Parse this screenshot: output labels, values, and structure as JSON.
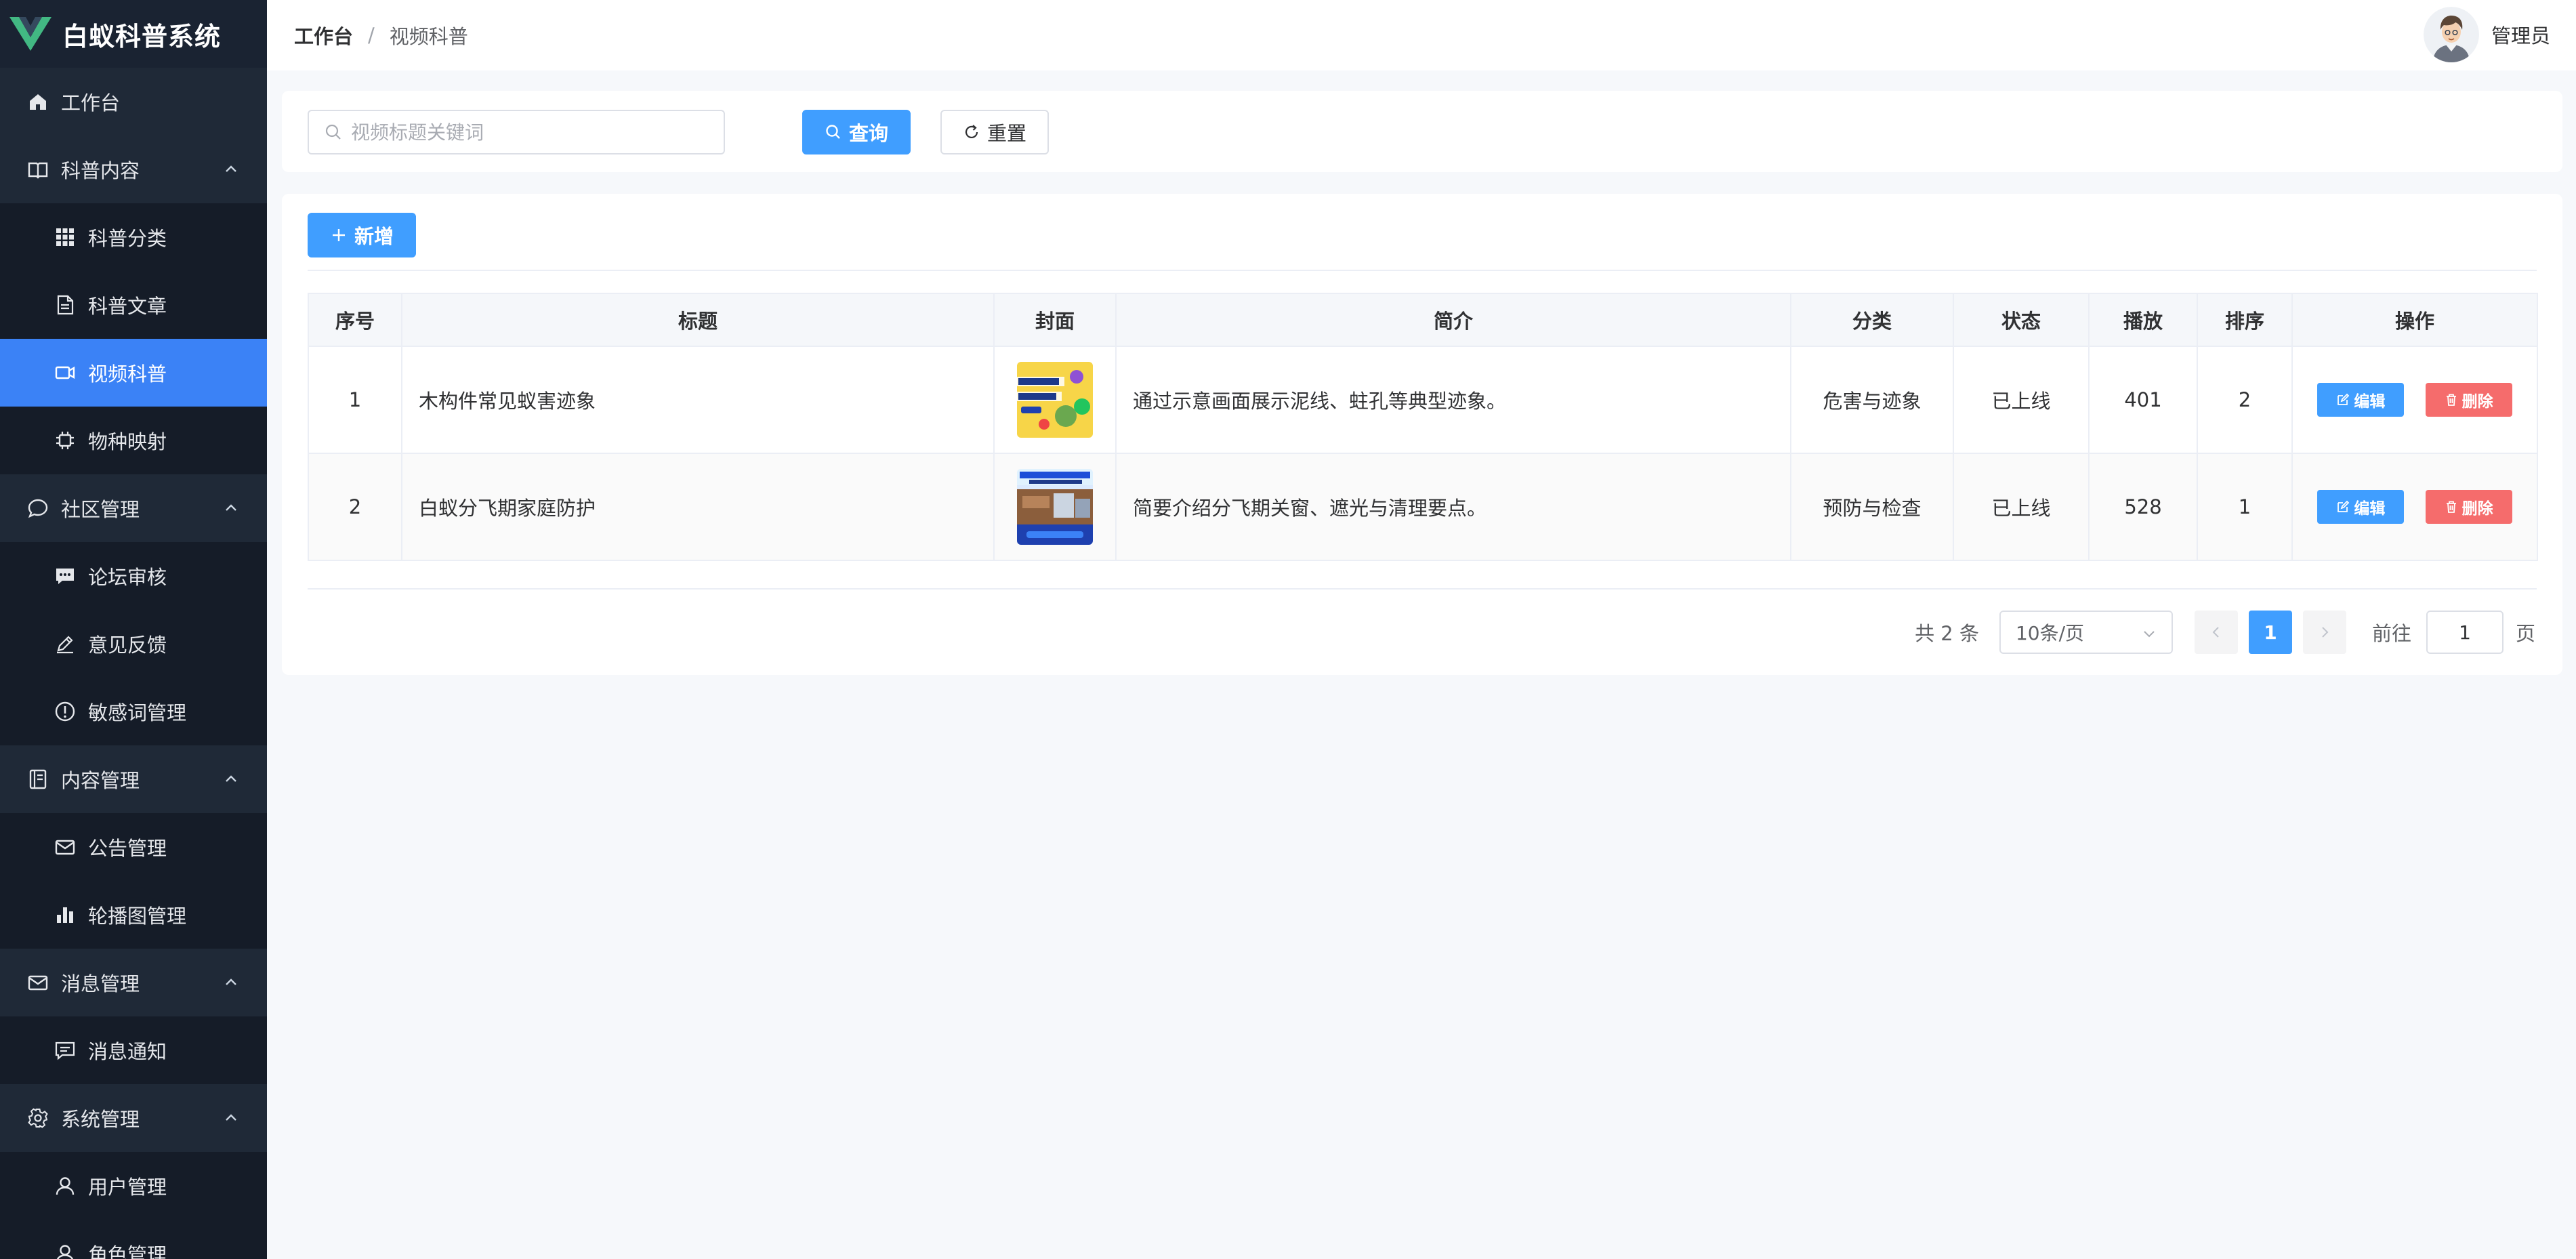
{
  "app": {
    "title": "白蚁科普系统",
    "accent_color": "#409eff",
    "sidebar_bg": "#1f2937",
    "danger_color": "#f56c6c"
  },
  "sidebar": {
    "items": [
      {
        "label": "工作台",
        "icon": "home-icon",
        "level": "top"
      },
      {
        "label": "科普内容",
        "icon": "book-icon",
        "level": "top",
        "expanded": true
      },
      {
        "label": "科普分类",
        "icon": "grid-icon",
        "level": "sub"
      },
      {
        "label": "科普文章",
        "icon": "document-icon",
        "level": "sub"
      },
      {
        "label": "视频科普",
        "icon": "video-icon",
        "level": "sub",
        "active": true
      },
      {
        "label": "物种映射",
        "icon": "cpu-icon",
        "level": "sub"
      },
      {
        "label": "社区管理",
        "icon": "chat-icon",
        "level": "top",
        "expanded": true
      },
      {
        "label": "论坛审核",
        "icon": "message-icon",
        "level": "sub"
      },
      {
        "label": "意见反馈",
        "icon": "edit-pen-icon",
        "level": "sub"
      },
      {
        "label": "敏感词管理",
        "icon": "warning-circle-icon",
        "level": "sub"
      },
      {
        "label": "内容管理",
        "icon": "notebook-icon",
        "level": "top",
        "expanded": true
      },
      {
        "label": "公告管理",
        "icon": "mail-icon",
        "level": "sub"
      },
      {
        "label": "轮播图管理",
        "icon": "bar-chart-icon",
        "level": "sub"
      },
      {
        "label": "消息管理",
        "icon": "mail-icon",
        "level": "top",
        "expanded": true
      },
      {
        "label": "消息通知",
        "icon": "chat-square-icon",
        "level": "sub"
      },
      {
        "label": "系统管理",
        "icon": "gear-icon",
        "level": "top",
        "expanded": true
      },
      {
        "label": "用户管理",
        "icon": "user-icon",
        "level": "sub"
      },
      {
        "label": "角色管理",
        "icon": "user-icon",
        "level": "sub"
      }
    ]
  },
  "header": {
    "breadcrumb_root": "工作台",
    "breadcrumb_sep": "/",
    "breadcrumb_current": "视频科普",
    "user_name": "管理员"
  },
  "search": {
    "placeholder": "视频标题关键词",
    "value": "",
    "query_label": "查询",
    "reset_label": "重置"
  },
  "toolbar": {
    "add_label": "新增"
  },
  "table": {
    "columns": [
      "序号",
      "标题",
      "封面",
      "简介",
      "分类",
      "状态",
      "播放",
      "排序",
      "操作"
    ],
    "rows": [
      {
        "index": "1",
        "title": "木构件常见蚁害迹象",
        "cover": "cover-yellow",
        "summary": "通过示意画面展示泥线、蛀孔等典型迹象。",
        "category": "危害与迹象",
        "status": "已上线",
        "plays": "401",
        "sort": "2",
        "edit": "编辑",
        "delete": "删除"
      },
      {
        "index": "2",
        "title": "白蚁分飞期家庭防护",
        "cover": "cover-blue",
        "summary": "简要介绍分飞期关窗、遮光与清理要点。",
        "category": "预防与检查",
        "status": "已上线",
        "plays": "528",
        "sort": "1",
        "edit": "编辑",
        "delete": "删除"
      }
    ]
  },
  "pagination": {
    "total_text": "共 2 条",
    "page_size": "10条/页",
    "current_page": "1",
    "goto_label": "前往",
    "goto_value": "1",
    "goto_suffix": "页"
  }
}
